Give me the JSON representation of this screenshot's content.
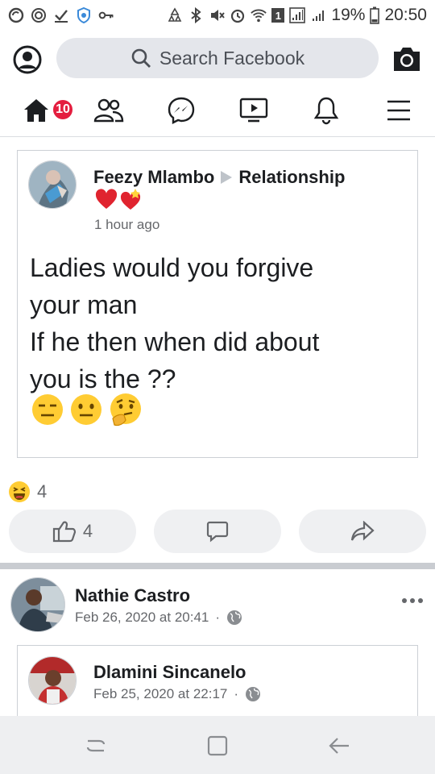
{
  "status_bar": {
    "battery": "19%",
    "time": "20:50",
    "sim_badge": "1"
  },
  "header": {
    "search_placeholder": "Search Facebook"
  },
  "tabs": {
    "home_badge": "10"
  },
  "shared_post": {
    "author": "Feezy Mlambo",
    "group": "Relationship",
    "time": "1 hour ago",
    "text_lines": [
      "Ladies would you forgive",
      "your man",
      "If he then when did about",
      "you is the ??"
    ]
  },
  "reactions": {
    "haha_count": "4"
  },
  "actions": {
    "like_count": "4"
  },
  "next_post": {
    "author": "Nathie Castro",
    "time": "Feb 26, 2020 at 20:41",
    "separator": "·",
    "inner_author": "Dlamini Sincanelo",
    "inner_time": "Feb 25, 2020 at 22:17"
  },
  "colors": {
    "brand": "#1877f2",
    "badge": "#e41e3f",
    "muted": "#65676b"
  }
}
